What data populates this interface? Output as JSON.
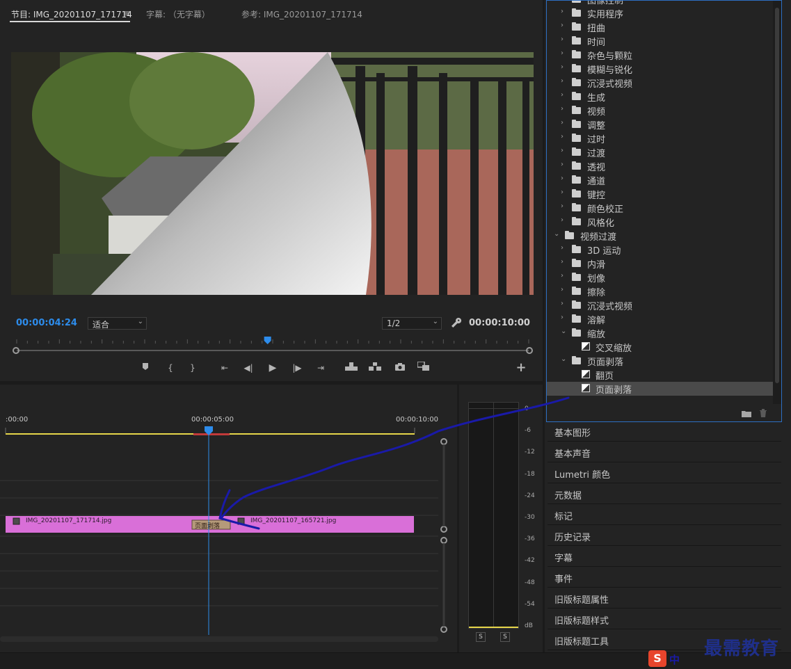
{
  "monitor": {
    "tabs": [
      {
        "label": "节目: IMG_20201107_171714"
      },
      {
        "label": "字幕: （无字幕）"
      },
      {
        "label": "参考: IMG_20201107_171714"
      }
    ],
    "menu_glyph": "≡",
    "current_time": "00:00:04:24",
    "fit_select": "适合",
    "resolution_select": "1/2",
    "duration": "00:00:10:00",
    "add_button": "+",
    "playhead_fraction": 0.49
  },
  "timeline": {
    "ruler_labels": [
      ":00:00",
      "00:00:05:00",
      "00:00:10:00"
    ],
    "clips": [
      {
        "name": "IMG_20201107_171714.jpg"
      },
      {
        "name": "IMG_20201107_165721.jpg"
      }
    ],
    "transition_label": "页面剥落"
  },
  "audio_meter": {
    "scale": [
      "0",
      "-6",
      "-12",
      "-18",
      "-24",
      "-30",
      "-36",
      "-42",
      "-48",
      "-54",
      "dB"
    ],
    "solo_buttons": [
      "S",
      "S"
    ]
  },
  "effects_tree": [
    {
      "label": "图像控制",
      "level": 1,
      "type": "folder",
      "expanded": false
    },
    {
      "label": "实用程序",
      "level": 1,
      "type": "folder",
      "expanded": false
    },
    {
      "label": "扭曲",
      "level": 1,
      "type": "folder",
      "expanded": false
    },
    {
      "label": "时间",
      "level": 1,
      "type": "folder",
      "expanded": false
    },
    {
      "label": "杂色与颗粒",
      "level": 1,
      "type": "folder",
      "expanded": false
    },
    {
      "label": "模糊与锐化",
      "level": 1,
      "type": "folder",
      "expanded": false
    },
    {
      "label": "沉浸式视频",
      "level": 1,
      "type": "folder",
      "expanded": false
    },
    {
      "label": "生成",
      "level": 1,
      "type": "folder",
      "expanded": false
    },
    {
      "label": "视频",
      "level": 1,
      "type": "folder",
      "expanded": false
    },
    {
      "label": "调整",
      "level": 1,
      "type": "folder",
      "expanded": false
    },
    {
      "label": "过时",
      "level": 1,
      "type": "folder",
      "expanded": false
    },
    {
      "label": "过渡",
      "level": 1,
      "type": "folder",
      "expanded": false
    },
    {
      "label": "透视",
      "level": 1,
      "type": "folder",
      "expanded": false
    },
    {
      "label": "通道",
      "level": 1,
      "type": "folder",
      "expanded": false
    },
    {
      "label": "键控",
      "level": 1,
      "type": "folder",
      "expanded": false
    },
    {
      "label": "颜色校正",
      "level": 1,
      "type": "folder",
      "expanded": false
    },
    {
      "label": "风格化",
      "level": 1,
      "type": "folder",
      "expanded": false
    },
    {
      "label": "视频过渡",
      "level": 0,
      "type": "folder",
      "expanded": true
    },
    {
      "label": "3D 运动",
      "level": 1,
      "type": "folder",
      "expanded": false
    },
    {
      "label": "内滑",
      "level": 1,
      "type": "folder",
      "expanded": false
    },
    {
      "label": "划像",
      "level": 1,
      "type": "folder",
      "expanded": false
    },
    {
      "label": "擦除",
      "level": 1,
      "type": "folder",
      "expanded": false
    },
    {
      "label": "沉浸式视频",
      "level": 1,
      "type": "folder",
      "expanded": false
    },
    {
      "label": "溶解",
      "level": 1,
      "type": "folder",
      "expanded": false
    },
    {
      "label": "缩放",
      "level": 1,
      "type": "folder",
      "expanded": true
    },
    {
      "label": "交叉缩放",
      "level": 2,
      "type": "effect"
    },
    {
      "label": "页面剥落",
      "level": 1,
      "type": "folder",
      "expanded": true
    },
    {
      "label": "翻页",
      "level": 2,
      "type": "effect"
    },
    {
      "label": "页面剥落",
      "level": 2,
      "type": "effect",
      "selected": true
    }
  ],
  "panels": [
    "基本图形",
    "基本声音",
    "Lumetri 颜色",
    "元数据",
    "标记",
    "历史记录",
    "字幕",
    "事件",
    "旧版标题属性",
    "旧版标题样式",
    "旧版标题工具"
  ],
  "watermark": {
    "text": "最需教育",
    "ime": "中"
  },
  "colors": {
    "accent_blue": "#2d8ceb",
    "clip_pink": "#d96fd8",
    "work_area_yellow": "#e6d64a",
    "selection_border": "#2d6fc3",
    "annotation_ink": "#1a1aa8"
  }
}
